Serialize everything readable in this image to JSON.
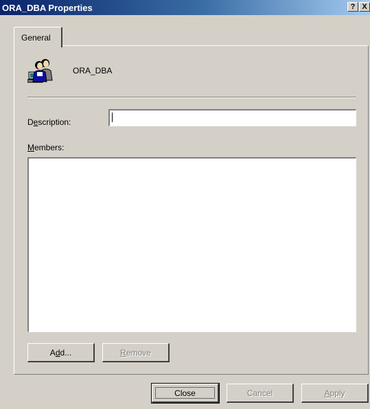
{
  "window": {
    "title": "ORA_DBA Properties",
    "help_button": "?",
    "close_button": "X"
  },
  "tabs": [
    {
      "label": "General",
      "selected": true
    }
  ],
  "group": {
    "icon": "user-group-icon",
    "name": "ORA_DBA"
  },
  "description": {
    "label_pre": "D",
    "label_accel": "e",
    "label_post": "scription:",
    "value": ""
  },
  "members": {
    "label_accel": "M",
    "label_post": "embers:",
    "items": []
  },
  "buttons": {
    "add": {
      "pre": "A",
      "accel": "d",
      "post": "d..."
    },
    "remove": {
      "pre": "",
      "accel": "R",
      "post": "emove",
      "disabled": true
    },
    "close": {
      "label": "Close"
    },
    "cancel": {
      "label": "Cancel",
      "disabled": true
    },
    "apply": {
      "pre": "",
      "accel": "A",
      "post": "pply",
      "disabled": true
    }
  },
  "colors": {
    "face": "#d4d0c8",
    "title_start": "#0a246a",
    "title_end": "#a6caf0"
  }
}
